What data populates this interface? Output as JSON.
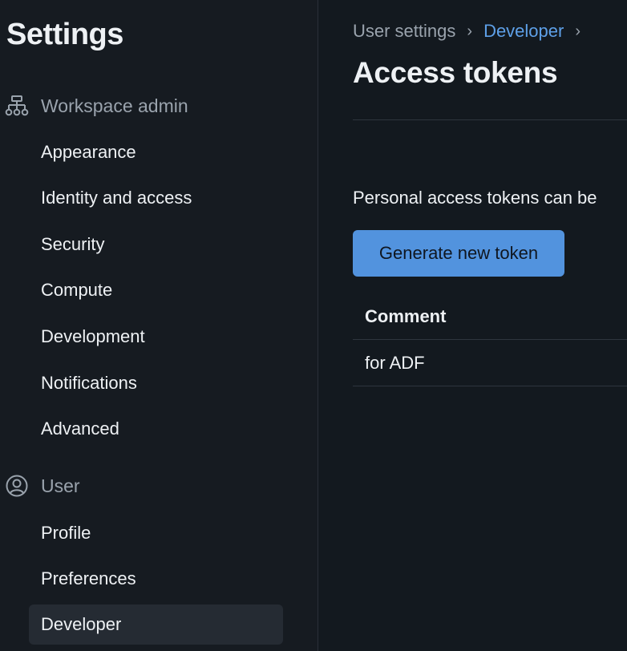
{
  "sidebar": {
    "title": "Settings",
    "sections": [
      {
        "header": "Workspace admin",
        "icon": "org-chart-icon",
        "items": [
          {
            "label": "Appearance"
          },
          {
            "label": "Identity and access"
          },
          {
            "label": "Security"
          },
          {
            "label": "Compute"
          },
          {
            "label": "Development"
          },
          {
            "label": "Notifications"
          },
          {
            "label": "Advanced"
          }
        ]
      },
      {
        "header": "User",
        "icon": "user-circle-icon",
        "items": [
          {
            "label": "Profile"
          },
          {
            "label": "Preferences"
          },
          {
            "label": "Developer",
            "active": true
          }
        ]
      }
    ]
  },
  "main": {
    "breadcrumb": [
      {
        "label": "User settings"
      },
      {
        "label": "Developer"
      }
    ],
    "breadcrumb_separator": "›",
    "title": "Access tokens",
    "description": "Personal access tokens can be",
    "generate_button_label": "Generate new token",
    "table": {
      "columns": [
        "Comment"
      ],
      "rows": [
        [
          "for ADF"
        ]
      ]
    }
  },
  "colors": {
    "accent": "#5293de",
    "link": "#5ea0e8",
    "background": "#13191f",
    "sidebar_background": "#161b21"
  }
}
